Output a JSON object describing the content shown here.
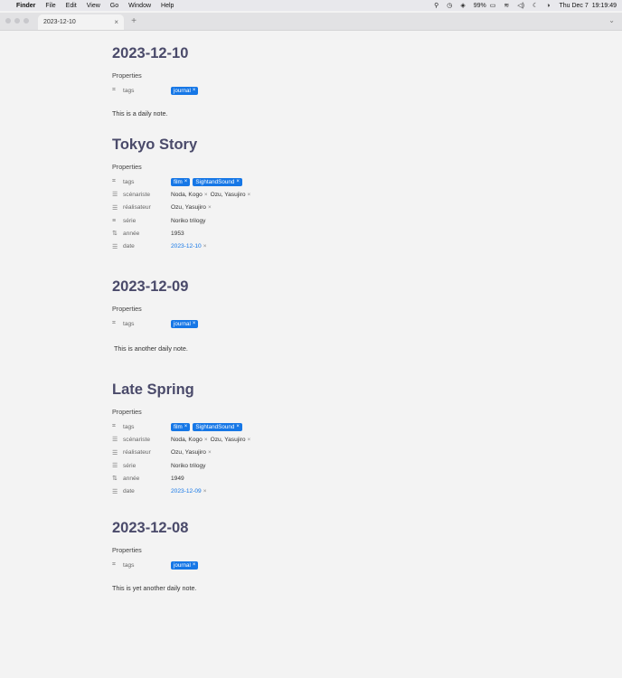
{
  "menubar": {
    "apple": "",
    "app_name": "Finder",
    "menus": [
      "File",
      "Edit",
      "View",
      "Go",
      "Window",
      "Help"
    ],
    "battery": "99%",
    "day": "Thu Dec 7",
    "time": "19:19:49"
  },
  "tabbar": {
    "active_tab": "2023-12-10",
    "close_glyph": "×",
    "new_tab_glyph": "+",
    "menu_glyph": "⌄"
  },
  "notes": [
    {
      "title": "2023-12-10",
      "properties_label": "Properties",
      "tags_key": "tags",
      "tags": [
        "journal"
      ],
      "body": "This is a daily note."
    },
    {
      "title": "Tokyo Story",
      "properties_label": "Properties",
      "tags_key": "tags",
      "tags": [
        "film",
        "SightandSound"
      ],
      "scenariste_key": "scénariste",
      "scenariste": [
        "Noda, Kogo",
        "Ozu, Yasujiro"
      ],
      "realisateur_key": "réalisateur",
      "realisateur": [
        "Ozu, Yasujiro"
      ],
      "serie_key": "série",
      "serie": "Noriko trilogy",
      "annee_key": "année",
      "annee": "1953",
      "date_key": "date",
      "date": "2023-12-10"
    },
    {
      "title": "2023-12-09",
      "properties_label": "Properties",
      "tags_key": "tags",
      "tags": [
        "journal"
      ],
      "body": "This is another daily note."
    },
    {
      "title": "Late Spring",
      "properties_label": "Properties",
      "tags_key": "tags",
      "tags": [
        "film",
        "SightandSound"
      ],
      "scenariste_key": "scénariste",
      "scenariste": [
        "Noda, Kogo",
        "Ozu, Yasujiro"
      ],
      "realisateur_key": "réalisateur",
      "realisateur": [
        "Ozu, Yasujiro"
      ],
      "serie_key": "série",
      "serie": "Noriko trilogy",
      "annee_key": "année",
      "annee": "1949",
      "date_key": "date",
      "date": "2023-12-09"
    },
    {
      "title": "2023-12-08",
      "properties_label": "Properties",
      "tags_key": "tags",
      "tags": [
        "journal"
      ],
      "body": "This is yet another daily note."
    }
  ],
  "icons": {
    "tag": "tag-icon",
    "list": "list-icon",
    "text": "text-icon",
    "number": "number-icon"
  },
  "colors": {
    "accent": "#1677e6",
    "title": "#4a4a6a",
    "background": "#f3f3f3"
  }
}
